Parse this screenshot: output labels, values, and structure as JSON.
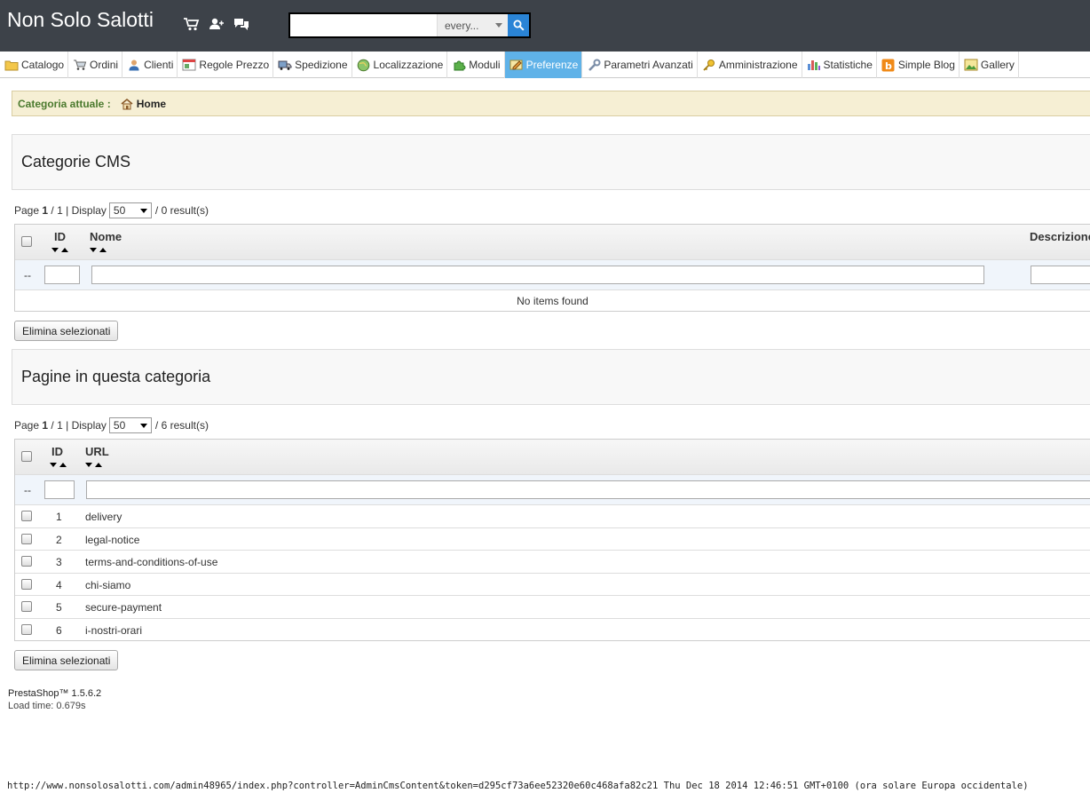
{
  "header": {
    "shop_name": "Non Solo Salotti",
    "search": {
      "value": "",
      "scope": "every..."
    }
  },
  "menu": [
    {
      "label": "Catalogo",
      "icon": "folder-icon"
    },
    {
      "label": "Ordini",
      "icon": "cart-icon"
    },
    {
      "label": "Clienti",
      "icon": "user-icon"
    },
    {
      "label": "Regole Prezzo",
      "icon": "price-rules-icon"
    },
    {
      "label": "Spedizione",
      "icon": "truck-icon"
    },
    {
      "label": "Localizzazione",
      "icon": "globe-icon"
    },
    {
      "label": "Moduli",
      "icon": "puzzle-icon"
    },
    {
      "label": "Preferenze",
      "icon": "preferences-icon"
    },
    {
      "label": "Parametri Avanzati",
      "icon": "wrench-icon"
    },
    {
      "label": "Amministrazione",
      "icon": "key-icon"
    },
    {
      "label": "Statistiche",
      "icon": "bar-chart-icon"
    },
    {
      "label": "Simple Blog",
      "icon": "blog-icon"
    },
    {
      "label": "Gallery",
      "icon": "image-icon"
    }
  ],
  "active_menu": "Preferenze",
  "breadcrumb": {
    "label": "Categoria attuale :",
    "home": "Home"
  },
  "categories": {
    "title": "Categorie CMS",
    "pager": {
      "page_label": "Page",
      "page": "1",
      "sep": "/",
      "pages": "1",
      "display_label": "| Display",
      "per_page": "50",
      "results": "/ 0 result(s)"
    },
    "columns": {
      "id": "ID",
      "name": "Nome",
      "description": "Descrizione"
    },
    "empty_text": "No items found",
    "delete_button": "Elimina selezionati"
  },
  "pages": {
    "title": "Pagine in questa categoria",
    "pager": {
      "page_label": "Page",
      "page": "1",
      "sep": "/",
      "pages": "1",
      "display_label": "| Display",
      "per_page": "50",
      "results": "/ 6 result(s)"
    },
    "columns": {
      "id": "ID",
      "url": "URL"
    },
    "rows": [
      {
        "id": "1",
        "url": "delivery"
      },
      {
        "id": "2",
        "url": "legal-notice"
      },
      {
        "id": "3",
        "url": "terms-and-conditions-of-use"
      },
      {
        "id": "4",
        "url": "chi-siamo"
      },
      {
        "id": "5",
        "url": "secure-payment"
      },
      {
        "id": "6",
        "url": "i-nostri-orari"
      }
    ],
    "delete_button": "Elimina selezionati"
  },
  "footer": {
    "version": "PrestaShop™ 1.5.6.2",
    "load_time": "Load time: 0.679s"
  },
  "filter_dash": "--",
  "status_url": "http://www.nonsolosalotti.com/admin48965/index.php?controller=AdminCmsContent&token=d295cf73a6ee52320e60c468afa82c21 Thu Dec 18 2014 12:46:51 GMT+0100 (ora solare Europa occidentale)"
}
